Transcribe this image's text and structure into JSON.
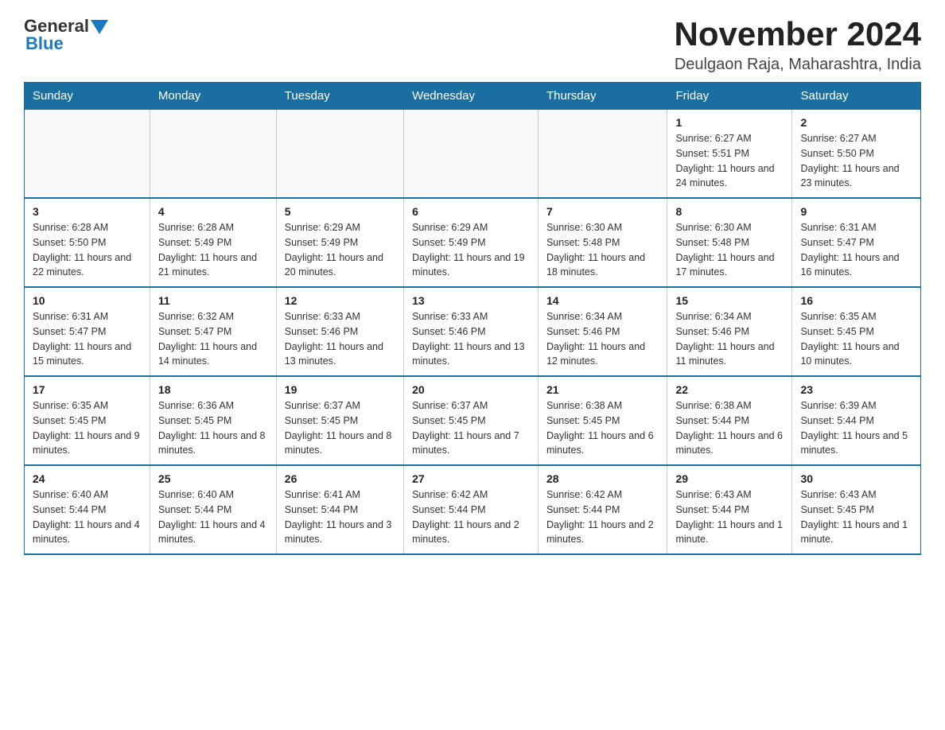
{
  "header": {
    "logo_general": "General",
    "logo_blue": "Blue",
    "title": "November 2024",
    "subtitle": "Deulgaon Raja, Maharashtra, India"
  },
  "days_of_week": [
    "Sunday",
    "Monday",
    "Tuesday",
    "Wednesday",
    "Thursday",
    "Friday",
    "Saturday"
  ],
  "weeks": [
    [
      {
        "day": "",
        "sunrise": "",
        "sunset": "",
        "daylight": ""
      },
      {
        "day": "",
        "sunrise": "",
        "sunset": "",
        "daylight": ""
      },
      {
        "day": "",
        "sunrise": "",
        "sunset": "",
        "daylight": ""
      },
      {
        "day": "",
        "sunrise": "",
        "sunset": "",
        "daylight": ""
      },
      {
        "day": "",
        "sunrise": "",
        "sunset": "",
        "daylight": ""
      },
      {
        "day": "1",
        "sunrise": "Sunrise: 6:27 AM",
        "sunset": "Sunset: 5:51 PM",
        "daylight": "Daylight: 11 hours and 24 minutes."
      },
      {
        "day": "2",
        "sunrise": "Sunrise: 6:27 AM",
        "sunset": "Sunset: 5:50 PM",
        "daylight": "Daylight: 11 hours and 23 minutes."
      }
    ],
    [
      {
        "day": "3",
        "sunrise": "Sunrise: 6:28 AM",
        "sunset": "Sunset: 5:50 PM",
        "daylight": "Daylight: 11 hours and 22 minutes."
      },
      {
        "day": "4",
        "sunrise": "Sunrise: 6:28 AM",
        "sunset": "Sunset: 5:49 PM",
        "daylight": "Daylight: 11 hours and 21 minutes."
      },
      {
        "day": "5",
        "sunrise": "Sunrise: 6:29 AM",
        "sunset": "Sunset: 5:49 PM",
        "daylight": "Daylight: 11 hours and 20 minutes."
      },
      {
        "day": "6",
        "sunrise": "Sunrise: 6:29 AM",
        "sunset": "Sunset: 5:49 PM",
        "daylight": "Daylight: 11 hours and 19 minutes."
      },
      {
        "day": "7",
        "sunrise": "Sunrise: 6:30 AM",
        "sunset": "Sunset: 5:48 PM",
        "daylight": "Daylight: 11 hours and 18 minutes."
      },
      {
        "day": "8",
        "sunrise": "Sunrise: 6:30 AM",
        "sunset": "Sunset: 5:48 PM",
        "daylight": "Daylight: 11 hours and 17 minutes."
      },
      {
        "day": "9",
        "sunrise": "Sunrise: 6:31 AM",
        "sunset": "Sunset: 5:47 PM",
        "daylight": "Daylight: 11 hours and 16 minutes."
      }
    ],
    [
      {
        "day": "10",
        "sunrise": "Sunrise: 6:31 AM",
        "sunset": "Sunset: 5:47 PM",
        "daylight": "Daylight: 11 hours and 15 minutes."
      },
      {
        "day": "11",
        "sunrise": "Sunrise: 6:32 AM",
        "sunset": "Sunset: 5:47 PM",
        "daylight": "Daylight: 11 hours and 14 minutes."
      },
      {
        "day": "12",
        "sunrise": "Sunrise: 6:33 AM",
        "sunset": "Sunset: 5:46 PM",
        "daylight": "Daylight: 11 hours and 13 minutes."
      },
      {
        "day": "13",
        "sunrise": "Sunrise: 6:33 AM",
        "sunset": "Sunset: 5:46 PM",
        "daylight": "Daylight: 11 hours and 13 minutes."
      },
      {
        "day": "14",
        "sunrise": "Sunrise: 6:34 AM",
        "sunset": "Sunset: 5:46 PM",
        "daylight": "Daylight: 11 hours and 12 minutes."
      },
      {
        "day": "15",
        "sunrise": "Sunrise: 6:34 AM",
        "sunset": "Sunset: 5:46 PM",
        "daylight": "Daylight: 11 hours and 11 minutes."
      },
      {
        "day": "16",
        "sunrise": "Sunrise: 6:35 AM",
        "sunset": "Sunset: 5:45 PM",
        "daylight": "Daylight: 11 hours and 10 minutes."
      }
    ],
    [
      {
        "day": "17",
        "sunrise": "Sunrise: 6:35 AM",
        "sunset": "Sunset: 5:45 PM",
        "daylight": "Daylight: 11 hours and 9 minutes."
      },
      {
        "day": "18",
        "sunrise": "Sunrise: 6:36 AM",
        "sunset": "Sunset: 5:45 PM",
        "daylight": "Daylight: 11 hours and 8 minutes."
      },
      {
        "day": "19",
        "sunrise": "Sunrise: 6:37 AM",
        "sunset": "Sunset: 5:45 PM",
        "daylight": "Daylight: 11 hours and 8 minutes."
      },
      {
        "day": "20",
        "sunrise": "Sunrise: 6:37 AM",
        "sunset": "Sunset: 5:45 PM",
        "daylight": "Daylight: 11 hours and 7 minutes."
      },
      {
        "day": "21",
        "sunrise": "Sunrise: 6:38 AM",
        "sunset": "Sunset: 5:45 PM",
        "daylight": "Daylight: 11 hours and 6 minutes."
      },
      {
        "day": "22",
        "sunrise": "Sunrise: 6:38 AM",
        "sunset": "Sunset: 5:44 PM",
        "daylight": "Daylight: 11 hours and 6 minutes."
      },
      {
        "day": "23",
        "sunrise": "Sunrise: 6:39 AM",
        "sunset": "Sunset: 5:44 PM",
        "daylight": "Daylight: 11 hours and 5 minutes."
      }
    ],
    [
      {
        "day": "24",
        "sunrise": "Sunrise: 6:40 AM",
        "sunset": "Sunset: 5:44 PM",
        "daylight": "Daylight: 11 hours and 4 minutes."
      },
      {
        "day": "25",
        "sunrise": "Sunrise: 6:40 AM",
        "sunset": "Sunset: 5:44 PM",
        "daylight": "Daylight: 11 hours and 4 minutes."
      },
      {
        "day": "26",
        "sunrise": "Sunrise: 6:41 AM",
        "sunset": "Sunset: 5:44 PM",
        "daylight": "Daylight: 11 hours and 3 minutes."
      },
      {
        "day": "27",
        "sunrise": "Sunrise: 6:42 AM",
        "sunset": "Sunset: 5:44 PM",
        "daylight": "Daylight: 11 hours and 2 minutes."
      },
      {
        "day": "28",
        "sunrise": "Sunrise: 6:42 AM",
        "sunset": "Sunset: 5:44 PM",
        "daylight": "Daylight: 11 hours and 2 minutes."
      },
      {
        "day": "29",
        "sunrise": "Sunrise: 6:43 AM",
        "sunset": "Sunset: 5:44 PM",
        "daylight": "Daylight: 11 hours and 1 minute."
      },
      {
        "day": "30",
        "sunrise": "Sunrise: 6:43 AM",
        "sunset": "Sunset: 5:45 PM",
        "daylight": "Daylight: 11 hours and 1 minute."
      }
    ]
  ]
}
